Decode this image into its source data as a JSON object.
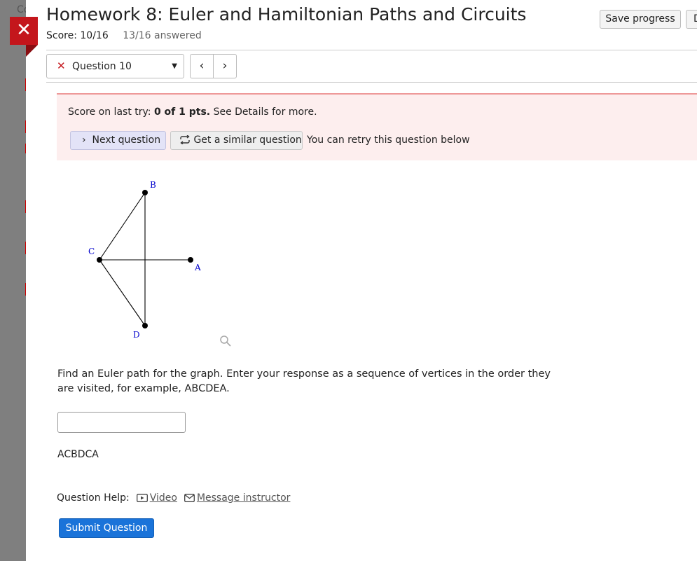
{
  "backdrop": {
    "title_fragment": "Co"
  },
  "header": {
    "title": "Homework 8: Euler and Hamiltonian Paths and Circuits",
    "score": "Score: 10/16",
    "answered": "13/16 answered",
    "save_label": "Save progress",
    "extra_label": "D"
  },
  "nav": {
    "question_select": "Question 10",
    "prev_icon": "chevron-left",
    "next_icon": "chevron-right"
  },
  "feedback": {
    "score_prefix": "Score on last try: ",
    "score_value": "0 of 1 pts.",
    "score_suffix": " See Details for more.",
    "next_question_label": "Next question",
    "similar_question_label": "Get a similar question",
    "retry_text": "You can retry this question below",
    "bg_color": "#fdeeee"
  },
  "graph": {
    "vertices": [
      "A",
      "B",
      "C",
      "D"
    ],
    "edges": [
      [
        "C",
        "B"
      ],
      [
        "C",
        "A"
      ],
      [
        "C",
        "D"
      ],
      [
        "B",
        "D"
      ]
    ],
    "label_color": "#0000cc"
  },
  "question": {
    "prompt": "Find an Euler path for the graph. Enter your response as a sequence of vertices in the order they are visited, for example, ABCDEA.",
    "answer_value": "",
    "previous_answer": "ACBDCA"
  },
  "help": {
    "label": "Question Help:",
    "video_label": "Video",
    "message_label": "Message instructor"
  },
  "submit_label": "Submit Question",
  "colors": {
    "close_red": "#c4161c",
    "submit_blue": "#1a73d9",
    "next_btn_bg": "#e3e3f7"
  }
}
